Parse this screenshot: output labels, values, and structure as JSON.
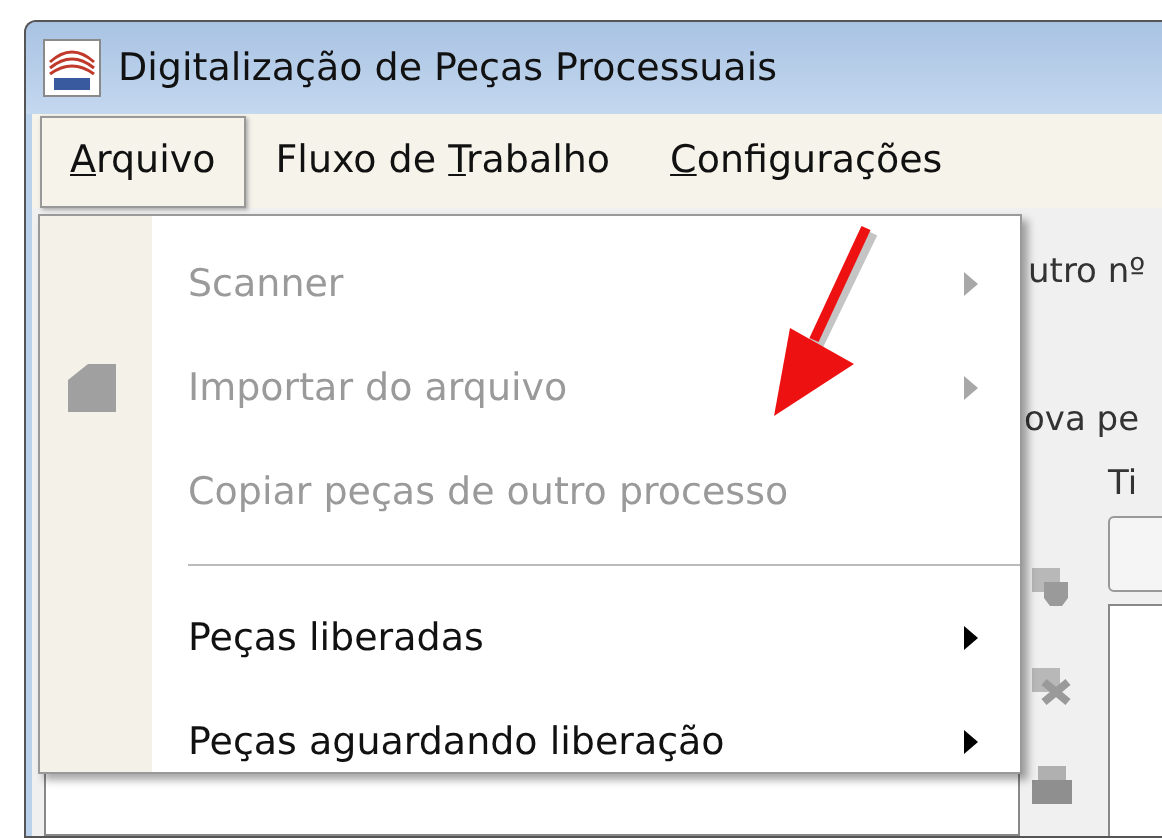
{
  "window": {
    "title": "Digitalização de Peças Processuais"
  },
  "menu_bar": [
    {
      "label": "Arquivo",
      "access_key": true,
      "selected": true
    },
    {
      "label": "Fluxo de Trabalho",
      "access_key": true,
      "selected": false
    },
    {
      "label": "Configurações",
      "access_key": true,
      "selected": false
    }
  ],
  "dropdown": [
    {
      "kind": "item",
      "label": "Scanner",
      "disabled": true,
      "submenu": true,
      "icon": false
    },
    {
      "kind": "item",
      "label": "Importar do arquivo",
      "disabled": true,
      "submenu": true,
      "icon": true
    },
    {
      "kind": "item",
      "label": "Copiar peças de outro processo",
      "disabled": true,
      "submenu": false,
      "icon": false
    },
    {
      "kind": "separator"
    },
    {
      "kind": "item",
      "label": "Peças liberadas",
      "disabled": false,
      "submenu": true,
      "icon": false
    },
    {
      "kind": "item",
      "label": "Peças aguardando liberação",
      "disabled": false,
      "submenu": true,
      "icon": false
    }
  ],
  "background": {
    "field_label": "utro nº",
    "section_label": "ova pe",
    "column_label": "Ti"
  }
}
